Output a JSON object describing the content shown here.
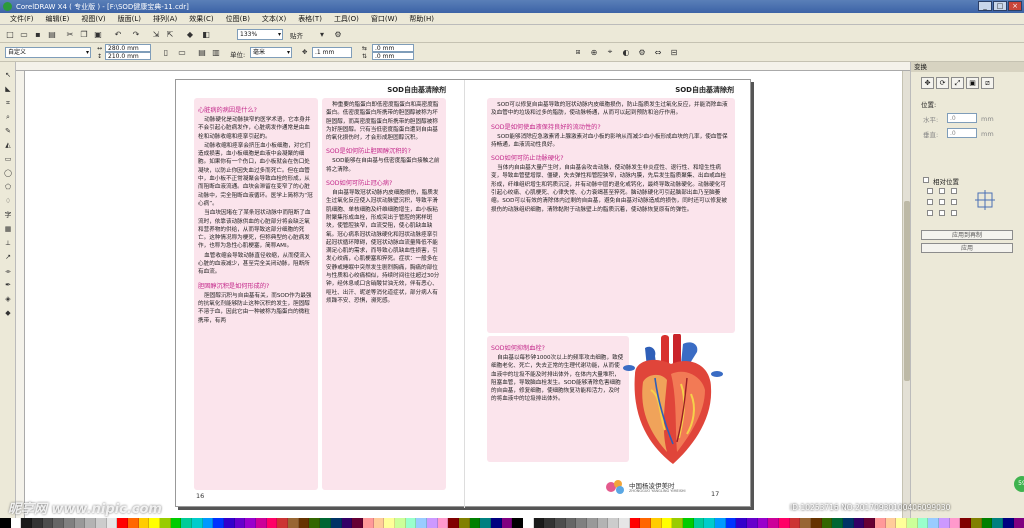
{
  "window": {
    "title": "CorelDRAW X4 ( 专业版 ) - [F:\\SOD健康宝典-11.cdr]"
  },
  "menu": [
    "文件(F)",
    "编辑(E)",
    "视图(V)",
    "版面(L)",
    "排列(A)",
    "效果(C)",
    "位图(B)",
    "文本(X)",
    "表格(T)",
    "工具(O)",
    "窗口(W)",
    "帮助(H)"
  ],
  "toolbar1": {
    "zoom": "133%",
    "snap": "贴齐"
  },
  "toolbar2": {
    "preset": "自定义",
    "width": "280.0 mm",
    "height": "210.0 mm",
    "units_label": "单位:",
    "units": "毫米",
    "nudge": ".1 mm",
    "dup_x": ".0 mm",
    "dup_y": ".0 mm"
  },
  "document": {
    "running_head": "SOD自由基清除剂",
    "left": {
      "page_number": "16",
      "col1": [
        {
          "h": "心脏病的病因是什么?"
        },
        {
          "p": "动脉硬化是动脉狭窄的医学术语，它本身并不会引起心脏病发作，心脏病发作通常是由血栓和动脉收缩和痉挛引起的。"
        },
        {
          "p": "动脉收缩和痉挛会挤压血小板细胞，对它们造成损害，血小板细胞是血液中会凝聚的细胞。如果你有一个伤口，血小板就会在伤口处凝块，以防止你因失血过多而死亡。但在血管中，血小板不正常凝聚会导致血栓的形成，从而阻断血液流通。血块会滞留在变窄了的心脏动脉中，完全阻断血液循环。医学上简称为“冠心病”。"
        },
        {
          "p": "当血块因堵在了某条冠状动脉中而阻断了血流时，依靠该动脉供血的心脏部分将会缺乏氧和营养物的供给，从而导致这部分细胞的死亡。这种情况称为梗死，但称典型的心脏病发作，也称为急性心肌梗塞，简称AMI。"
        },
        {
          "p": "血管收缩会导致动脉直径收缩，从而使流入心脏的血液减少，甚至完全关闭动脉，阻断所有血流。"
        },
        {
          "h": "胆固醇沉积是如何形成的?"
        },
        {
          "p": "胆固醇沉积与自由基有关，而SOD作为最强的抗氧化剂能够防止这种沉积的发生，胆固醇不溶于血，因此它由一种被称为脂蛋白的微粒携带，有两"
        }
      ],
      "col2": [
        {
          "p": "种重要的脂蛋白即低密度脂蛋白和高密度脂蛋白。低密度脂蛋白所携带的胆固醇被称为坏胆固醇，而高密度脂蛋白所携带的胆固醇被称为好胆固醇。只有当低密度脂蛋白遭到自由基的氧化损伤时，才会形成胆固醇沉积。"
        },
        {
          "h": "SOD是如何防止胆固醇沉积的?"
        },
        {
          "p": "SOD能够在自由基与低密度脂蛋白接触之前将之清除。"
        },
        {
          "h": "SOD如何可防止冠心病?"
        },
        {
          "p": "自由基导致冠状动脉内皮细胞损伤，脂质发生过氧化反应使入冠状动脉壁沉积，导致平滑肌细胞、单核细胞及纤维细胞增生，血小板粘附聚集形成血栓，形成突出于管腔的粥样斑块，使管腔狭窄，血流受阻，使心肌缺血缺氧。冠心病系冠状动脉硬化和冠状动脉痉挛引起冠状循环障碍，使冠状动脉血流量降低不能满足心肌的需求，而导致心肌缺血性损害，引发心绞痛，心肌梗塞和猝死。症状：一般多在安静或睡眠中突然发生剧烈胸痛，胸痛的部位与性质和心绞痛相似，持续时间往往超过30分钟，经休息或口含硝酸甘油无效，伴有恶心、呕吐、出汗、昵逆等消化道症状，部分病人有烦躁不安、恐惧，濒死感。"
        }
      ]
    },
    "right": {
      "page_number": "17",
      "logo_text": "中国杨凌伊美时",
      "logo_subtext": "ZHONGGUO YANGLING YIMEISHI",
      "top_box": [
        {
          "p": "SOD可以修复自由基导致的冠状动脉内皮细胞损伤，防止脂质发生过氧化反应，并能消除血液及血管中的垃圾和过多的脂肪，使动脉畅通，从而可以起到预防和治疗作用。"
        },
        {
          "h": "SOD是如何使血液保持良好的流动性的?"
        },
        {
          "p": "SOD能够消除应急激素肾上腺激素对血小板的影响从而减少血小板形成血块的几率，使血管保持畅通，血液流动性良好。"
        },
        {
          "h": "SOD如何可防止动脉硬化?"
        },
        {
          "p": "当体内自由基大量产生时，自由基会攻击动脉，使动脉发生非炎症性、退行性、和增生性病变，导致血管壁增厚、僵硬，失去弹性和管腔狭窄，动脉内膜，先后发生脂质聚集、出血或血栓形成，纤维组织增生和钙质沉淀，并有动脉中层的退化或钙化，最终导致动脉硬化。动脉硬化可引起心绞痛、心肌梗死、心律失常、心力衰竭甚至猝死。脑动脉硬化可引起脑部出血乃至脑萎缩。SOD可以有效的清除体内过剩的自由基，避免自由基对动脉造成的损伤，同时还可以修复被损伤的动脉组织细胞，清除黏附于动脉壁上的脂质沉着，使动脉恢复原有的弹性。"
        }
      ],
      "bottom_box": [
        {
          "h": "SOD如何抑制血栓?"
        },
        {
          "p": "自由基以每秒钟1000次以上的频率攻击细胞，致使细胞老化、死亡，失去正常的生理代谢功能，从而使血液中的垃圾不能及时排出体外，在体内大量堆积，阻塞血管，导致脑血栓发生。SOD能够清除危害细胞的自由基，修复细胞，使细胞恢复功能和活力，及时的将血液中的垃圾排出体外。"
        }
      ]
    }
  },
  "docker": {
    "title": "变换",
    "position_label": "位置:",
    "horizontal_label": "水平:",
    "vertical_label": "垂直:",
    "h_value": ".0",
    "v_value": ".0",
    "unit": "mm",
    "relative_label": "相对位置",
    "apply_copy": "应用到再制",
    "apply": "应用"
  },
  "watermark": "昵享网 www.nipic.com",
  "watermark_id": "ID:10253716 NO:20170930100406099030",
  "colors": {
    "pink_box": "#fbe4ec",
    "heading": "#c3288a",
    "titlebar": "#3c63a6"
  }
}
